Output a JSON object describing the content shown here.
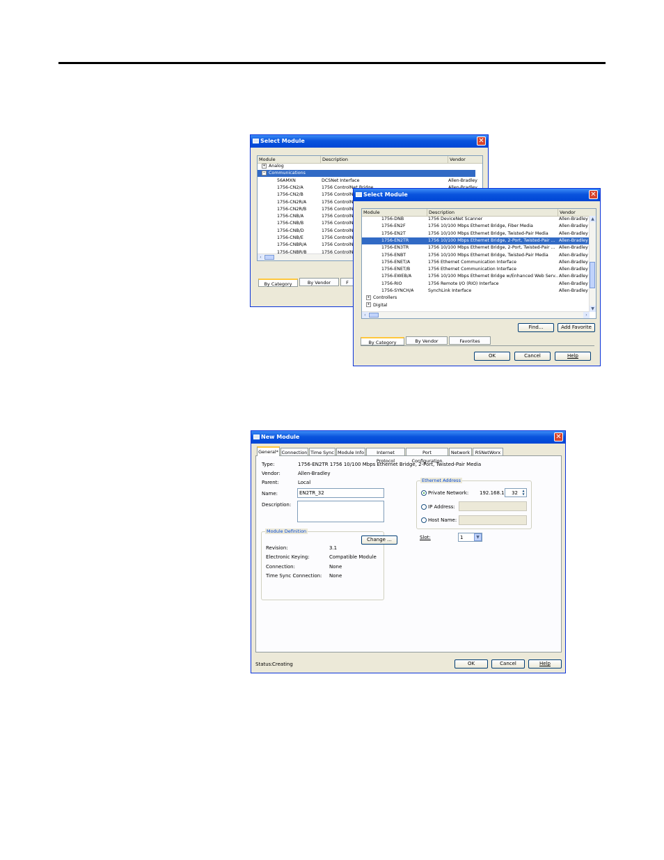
{
  "dialog_back": {
    "title": "Select Module",
    "columns": [
      "Module",
      "Description",
      "Vendor"
    ],
    "rows": [
      {
        "module": "Analog",
        "exp": "+",
        "desc": "",
        "vendor": ""
      },
      {
        "module": "Communications",
        "exp": "−",
        "desc": "",
        "vendor": "",
        "selected": true
      },
      {
        "module": "56AMXN",
        "desc": "DCSNet Interface",
        "vendor": "Allen-Bradley"
      },
      {
        "module": "1756-CN2/A",
        "desc": "1756 ControlNet Bridge",
        "vendor": "Allen-Bradley"
      },
      {
        "module": "1756-CN2/B",
        "desc": "1756 ControlNe",
        "vendor": ""
      },
      {
        "module": "1756-CN2R/A",
        "desc": "1756 ControlNe",
        "vendor": ""
      },
      {
        "module": "1756-CN2R/B",
        "desc": "1756 ControlNe",
        "vendor": ""
      },
      {
        "module": "1756-CNB/A",
        "desc": "1756 ControlNe",
        "vendor": ""
      },
      {
        "module": "1756-CNB/B",
        "desc": "1756 ControlNe",
        "vendor": ""
      },
      {
        "module": "1756-CNB/D",
        "desc": "1756 ControlNe",
        "vendor": ""
      },
      {
        "module": "1756-CNB/E",
        "desc": "1756 ControlNe",
        "vendor": ""
      },
      {
        "module": "1756-CNBR/A",
        "desc": "1756 ControlNe",
        "vendor": ""
      },
      {
        "module": "1756-CNBR/B",
        "desc": "1756 ControlNe",
        "vendor": ""
      }
    ],
    "tabs": [
      "By Category",
      "By Vendor",
      "F"
    ]
  },
  "dialog_front": {
    "title": "Select Module",
    "columns": [
      "Module",
      "Description",
      "Vendor"
    ],
    "rows": [
      {
        "module": "1756-DNB",
        "desc": "1756 DeviceNet Scanner",
        "vendor": "Allen-Bradley"
      },
      {
        "module": "1756-EN2F",
        "desc": "1756 10/100 Mbps Ethernet Bridge, Fiber Media",
        "vendor": "Allen-Bradley"
      },
      {
        "module": "1756-EN2T",
        "desc": "1756 10/100 Mbps Ethernet Bridge, Twisted-Pair Media",
        "vendor": "Allen-Bradley"
      },
      {
        "module": "1756-EN2TR",
        "desc": "1756 10/100 Mbps Ethernet Bridge, 2-Port, Twisted-Pair ...",
        "vendor": "Allen-Bradley",
        "selected": true
      },
      {
        "module": "1756-EN3TR",
        "desc": "1756 10/100 Mbps Ethernet Bridge, 2-Port, Twisted-Pair ...",
        "vendor": "Allen-Bradley"
      },
      {
        "module": "1756-ENBT",
        "desc": "1756 10/100 Mbps Ethernet Bridge, Twisted-Pair Media",
        "vendor": "Allen-Bradley"
      },
      {
        "module": "1756-ENET/A",
        "desc": "1756 Ethernet Communication Interface",
        "vendor": "Allen-Bradley"
      },
      {
        "module": "1756-ENET/B",
        "desc": "1756 Ethernet Communication Interface",
        "vendor": "Allen-Bradley"
      },
      {
        "module": "1756-EWEB/A",
        "desc": "1756 10/100 Mbps Ethernet Bridge w/Enhanced Web Serv...",
        "vendor": "Allen-Bradley"
      },
      {
        "module": "1756-RIO",
        "desc": "1756 Remote I/O (RIO) Interface",
        "vendor": "Allen-Bradley"
      },
      {
        "module": "1756-SYNCH/A",
        "desc": "SynchLink Interface",
        "vendor": "Allen-Bradley"
      },
      {
        "module": "Controllers",
        "exp": "+",
        "desc": "",
        "vendor": ""
      },
      {
        "module": "Digital",
        "exp": "+",
        "desc": "",
        "vendor": ""
      }
    ],
    "find_label": "Find...",
    "add_favorite_label": "Add Favorite",
    "tabs": [
      "By Category",
      "By Vendor",
      "Favorites"
    ],
    "ok_label": "OK",
    "cancel_label": "Cancel",
    "help_label": "Help"
  },
  "new_module": {
    "title": "New Module",
    "tabs": [
      "General*",
      "Connection",
      "Time Sync",
      "Module Info",
      "Internet Protocol",
      "Port Configuration",
      "Network",
      "RSNetWorx"
    ],
    "type_label": "Type:",
    "type_value": "1756-EN2TR 1756 10/100 Mbps Ethernet Bridge, 2-Port, Twisted-Pair Media",
    "vendor_label": "Vendor:",
    "vendor_value": "Allen-Bradley",
    "parent_label": "Parent:",
    "parent_value": "Local",
    "name_label": "Name:",
    "name_value": "EN2TR_32",
    "description_label": "Description:",
    "description_value": "",
    "module_def": {
      "legend": "Module Definition",
      "change_label": "Change ...",
      "revision_label": "Revision:",
      "revision_value": "3.1",
      "keying_label": "Electronic Keying:",
      "keying_value": "Compatible Module",
      "connection_label": "Connection:",
      "connection_value": "None",
      "timesync_label": "Time Sync Connection:",
      "timesync_value": "None"
    },
    "ethernet": {
      "legend": "Ethernet Address",
      "private_label": "Private Network:",
      "private_prefix": "192.168.1.",
      "private_value": "32",
      "ip_label": "IP Address:",
      "host_label": "Host Name:"
    },
    "slot_label": "Slot:",
    "slot_value": "1",
    "status_label": "Status:",
    "status_value": "Creating",
    "ok_label": "OK",
    "cancel_label": "Cancel",
    "help_label": "Help"
  }
}
